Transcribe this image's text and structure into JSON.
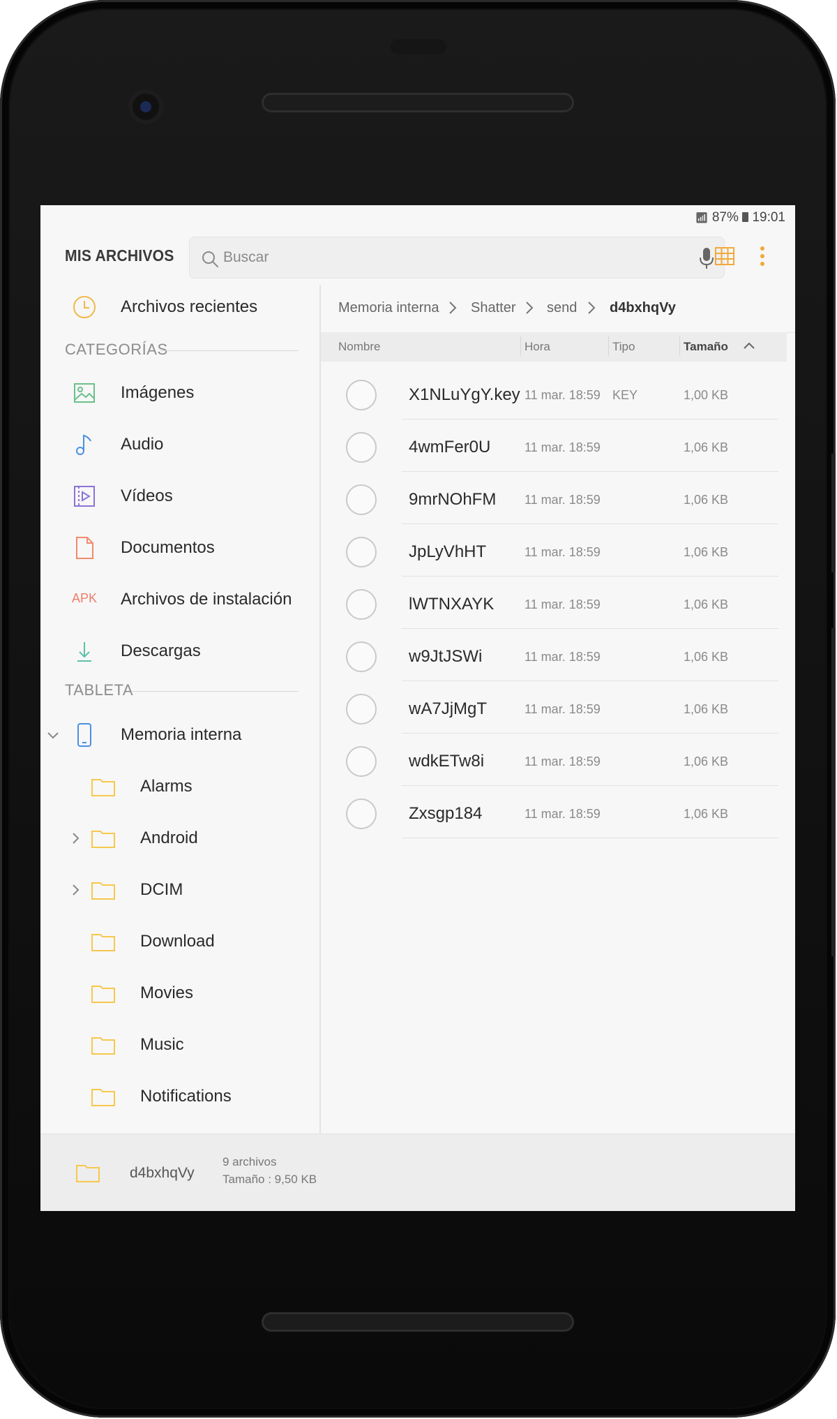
{
  "status_bar": {
    "battery": "87%",
    "time": "19:01"
  },
  "app": {
    "title": "MIS ARCHIVOS"
  },
  "search": {
    "placeholder": "Buscar"
  },
  "sidebar": {
    "recent": "Archivos recientes",
    "categories_header": "CATEGORÍAS",
    "categories": [
      {
        "label": "Imágenes",
        "icon": "image-icon"
      },
      {
        "label": "Audio",
        "icon": "music-note-icon"
      },
      {
        "label": "Vídeos",
        "icon": "video-icon"
      },
      {
        "label": "Documentos",
        "icon": "document-icon"
      },
      {
        "label": "Archivos de instalación",
        "icon": "apk-icon",
        "icon_text": "APK"
      },
      {
        "label": "Descargas",
        "icon": "download-icon"
      }
    ],
    "tablet_header": "TABLETA",
    "storage": {
      "label": "Memoria interna"
    },
    "folders": [
      {
        "label": "Alarms",
        "expandable": false
      },
      {
        "label": "Android",
        "expandable": true
      },
      {
        "label": "DCIM",
        "expandable": true
      },
      {
        "label": "Download",
        "expandable": false
      },
      {
        "label": "Movies",
        "expandable": false
      },
      {
        "label": "Music",
        "expandable": false
      },
      {
        "label": "Notifications",
        "expandable": false
      }
    ]
  },
  "breadcrumb": [
    "Memoria interna",
    "Shatter",
    "send",
    "d4bxhqVy"
  ],
  "columns": {
    "name": "Nombre",
    "time": "Hora",
    "type": "Tipo",
    "size": "Tamaño"
  },
  "files": [
    {
      "name": "X1NLuYgY.key",
      "time": "11 mar. 18:59",
      "type": "KEY",
      "size": "1,00 KB"
    },
    {
      "name": "4wmFer0U",
      "time": "11 mar. 18:59",
      "type": "",
      "size": "1,06 KB"
    },
    {
      "name": "9mrNOhFM",
      "time": "11 mar. 18:59",
      "type": "",
      "size": "1,06 KB"
    },
    {
      "name": "JpLyVhHT",
      "time": "11 mar. 18:59",
      "type": "",
      "size": "1,06 KB"
    },
    {
      "name": "lWTNXAYK",
      "time": "11 mar. 18:59",
      "type": "",
      "size": "1,06 KB"
    },
    {
      "name": "w9JtJSWi",
      "time": "11 mar. 18:59",
      "type": "",
      "size": "1,06 KB"
    },
    {
      "name": "wA7JjMgT",
      "time": "11 mar. 18:59",
      "type": "",
      "size": "1,06 KB"
    },
    {
      "name": "wdkETw8i",
      "time": "11 mar. 18:59",
      "type": "",
      "size": "1,06 KB"
    },
    {
      "name": "Zxsgp184",
      "time": "11 mar. 18:59",
      "type": "",
      "size": "1,06 KB"
    }
  ],
  "footer": {
    "folder": "d4bxhqVy",
    "count": "9 archivos",
    "size": "Tamaño : 9,50 KB"
  },
  "colors": {
    "accent": "#f2a93b",
    "folder": "#f6c84c",
    "apk": "#ef7c6a",
    "audio": "#4a90e2",
    "video": "#8b74d6",
    "doc": "#f08a6e",
    "image": "#6cc08b",
    "download": "#5bbfa8"
  }
}
